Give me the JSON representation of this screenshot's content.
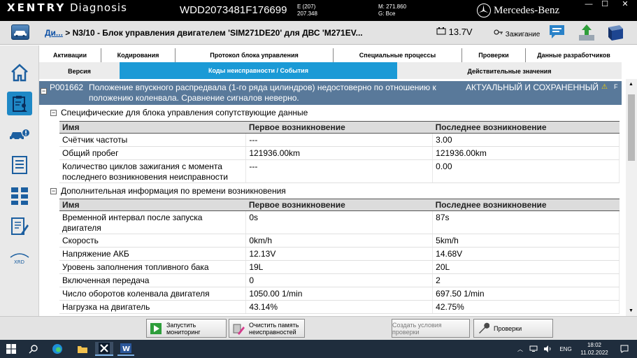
{
  "titlebar": {
    "brand_bold": "XENTRY",
    "brand_text": "Diagnosis",
    "vin": "WDD2073481F176699",
    "model_e": "E (207)",
    "model_code": "207.348",
    "m_code": "M: 271.860",
    "g_code": "G: Все",
    "make": "Mercedes-Benz",
    "min_glyph": "—",
    "max_glyph": "☐",
    "close_glyph": "✕"
  },
  "header": {
    "crumb_link": "Ди...",
    "crumb_text": "> N3/10 - Блок управления двигателем 'SIM271DE20' для ДВС 'M271EV...",
    "voltage": "13.7V",
    "ignition": "Зажигание"
  },
  "tabs_row1": [
    "Активации",
    "Кодирования",
    "Протокол блока управления",
    "Специальные процессы",
    "Проверки",
    "Данные разработчиков"
  ],
  "tabs_row2": [
    "Версия",
    "Коды неисправности / События",
    "Действительные значения"
  ],
  "fault": {
    "code": "P001662",
    "description": "Положение впускного распредвала (1-го ряда цилиндров) недостоверно по отношению к положению коленвала. Сравнение сигналов неверно.",
    "status": "АКТУАЛЬНЫЙ И СОХРАНЕННЫЙ",
    "warn": "⚠",
    "flag": "F"
  },
  "section1": {
    "title": "Специфические для блока управления сопутствующие данные",
    "headers": [
      "Имя",
      "Первое возникновение",
      "Последнее возникновение"
    ],
    "rows": [
      [
        "Счётчик частоты",
        "---",
        "3.00"
      ],
      [
        "Общий пробег",
        "121936.00km",
        "121936.00km"
      ],
      [
        "Количество циклов зажигания с момента последнего возникновения неисправности",
        "---",
        "0.00"
      ]
    ]
  },
  "section2": {
    "title": "Дополнительная информация по времени возникновения",
    "headers": [
      "Имя",
      "Первое возникновение",
      "Последнее возникновение"
    ],
    "rows": [
      [
        "Временной интервал после запуска двигателя",
        "0s",
        "87s"
      ],
      [
        "Скорость",
        "0km/h",
        "5km/h"
      ],
      [
        "Напряжение АКБ",
        "12.13V",
        "14.68V"
      ],
      [
        "Уровень заполнения топливного бака",
        "19L",
        "20L"
      ],
      [
        "Включенная передача",
        "0",
        "2"
      ],
      [
        "Число оборотов коленвала двигателя",
        "1050.00 1/min",
        "697.50 1/min"
      ],
      [
        "Нагрузка на двигатель",
        "43.14%",
        "42.75%"
      ]
    ]
  },
  "bottom_buttons": {
    "start_monitoring": "Запустить мониторинг",
    "clear_memory": "Очистить память неисправностей",
    "create_conditions": "Создать условия проверки",
    "checks": "Проверки"
  },
  "taskbar": {
    "lang": "ENG",
    "time": "18:02",
    "date": "11.02.2022",
    "accent": "#1f2d3d"
  },
  "colors": {
    "fault_bar": "#59799a",
    "tab_selected": "#1b9ad6",
    "link": "#0b4fa5"
  }
}
